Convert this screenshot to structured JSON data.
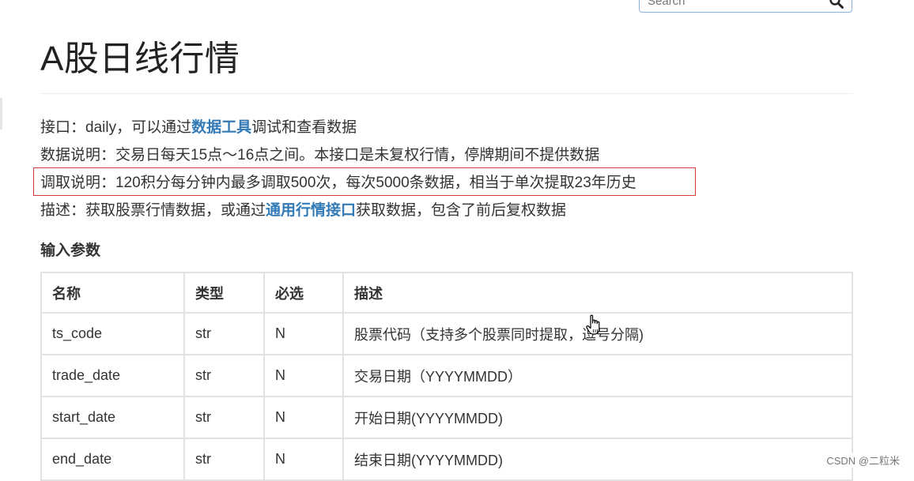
{
  "search": {
    "placeholder": "Search"
  },
  "page": {
    "title": "A股日线行情"
  },
  "paragraphs": [
    {
      "prefix": "接口：daily，可以通过",
      "link": "数据工具",
      "suffix": "调试和查看数据"
    },
    {
      "text": "数据说明：交易日每天15点～16点之间。本接口是未复权行情，停牌期间不提供数据"
    },
    {
      "text": "调取说明：120积分每分钟内最多调取500次，每次5000条数据，相当于单次提取23年历史"
    },
    {
      "prefix": "描述：获取股票行情数据，或通过",
      "link": "通用行情接口",
      "suffix": "获取数据，包含了前后复权数据"
    }
  ],
  "input_params": {
    "heading": "输入参数",
    "columns": [
      "名称",
      "类型",
      "必选",
      "描述"
    ],
    "rows": [
      [
        "ts_code",
        "str",
        "N",
        "股票代码（支持多个股票同时提取，逗号分隔)"
      ],
      [
        "trade_date",
        "str",
        "N",
        "交易日期（YYYYMMDD）"
      ],
      [
        "start_date",
        "str",
        "N",
        "开始日期(YYYYMMDD)"
      ],
      [
        "end_date",
        "str",
        "N",
        "结束日期(YYYYMMDD)"
      ]
    ]
  },
  "watermark": "CSDN @二粒米",
  "colors": {
    "link": "#337ab7",
    "highlight_border": "#d9383a",
    "table_border": "#e2e2e2"
  },
  "icons": [
    "search-icon",
    "hand-cursor-icon"
  ]
}
